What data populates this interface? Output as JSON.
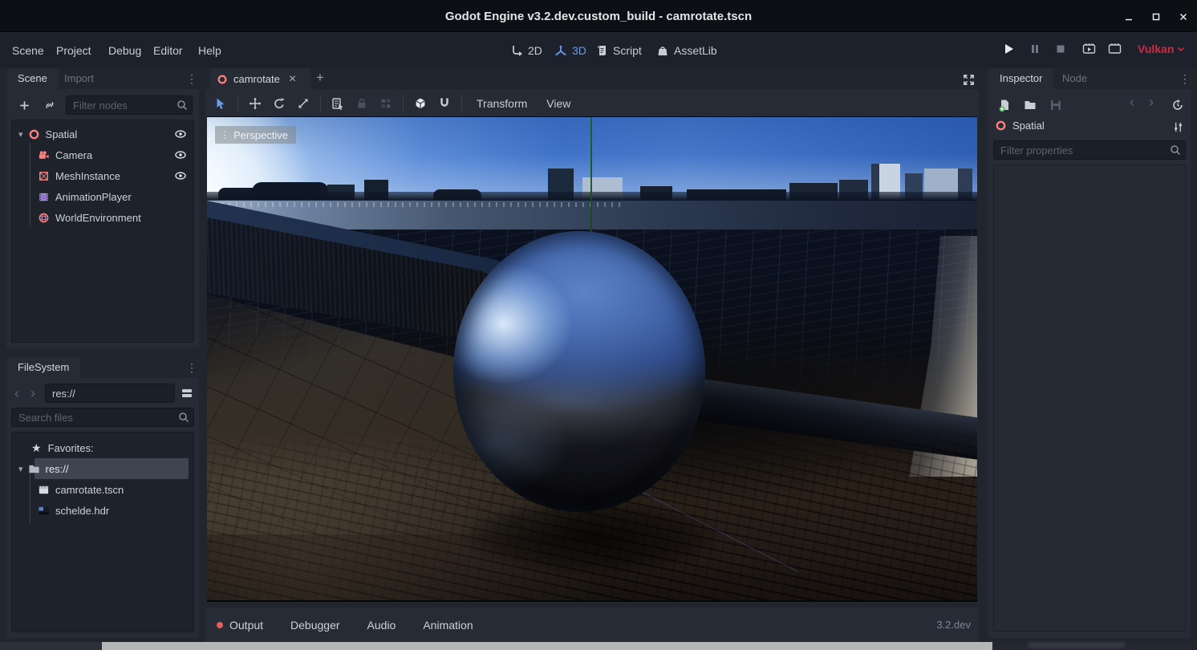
{
  "window": {
    "title": "Godot Engine v3.2.dev.custom_build - camrotate.tscn"
  },
  "menu_bar": {
    "items": [
      {
        "label": "Scene"
      },
      {
        "label": "Project"
      },
      {
        "label": "Debug"
      },
      {
        "label": "Editor"
      },
      {
        "label": "Help"
      }
    ]
  },
  "workspaces": {
    "d2": "2D",
    "d3": "3D",
    "script": "Script",
    "assetlib": "AssetLib"
  },
  "playback": {
    "renderer": "Vulkan"
  },
  "glyphs": {
    "menu_dots": "⋮",
    "close": "×",
    "add_tab": "+",
    "star": "★",
    "chev_left": "‹",
    "chev_right": "›",
    "caret_down": "▾",
    "drag_dots": "⋮"
  },
  "scene_dock": {
    "tab_scene": "Scene",
    "tab_import": "Import",
    "filter_placeholder": "Filter nodes",
    "nodes": [
      {
        "name": "Spatial",
        "visible": true
      },
      {
        "name": "Camera",
        "visible": true
      },
      {
        "name": "MeshInstance",
        "visible": true
      },
      {
        "name": "AnimationPlayer",
        "visible": false
      },
      {
        "name": "WorldEnvironment",
        "visible": false
      }
    ]
  },
  "filesystem_dock": {
    "title": "FileSystem",
    "path": "res://",
    "search_placeholder": "Search files",
    "favorites_label": "Favorites:",
    "folder": "res://",
    "file_scene": "camrotate.tscn",
    "file_hdr": "schelde.hdr"
  },
  "main": {
    "scene_tab": "camrotate",
    "menu_transform": "Transform",
    "menu_view": "View",
    "perspective": "Perspective"
  },
  "bottom_bar": {
    "output": "Output",
    "debugger": "Debugger",
    "audio": "Audio",
    "animation": "Animation",
    "version": "3.2.dev"
  },
  "inspector_dock": {
    "tab_inspector": "Inspector",
    "tab_node": "Node",
    "object_name": "Spatial",
    "filter_placeholder": "Filter properties"
  },
  "colors": {
    "accent_blue": "#699ce8",
    "node_red": "#fc7f7f",
    "node_purple": "#b18ff1",
    "renderer_red": "#cd2c44",
    "panel": "#262b35",
    "panel_dark": "#1d222b",
    "input": "#1b1f27",
    "text": "#ccd0d6",
    "text_dim": "#6b7280",
    "selection": "#3f4550",
    "output_dot": "#e45c5c"
  }
}
